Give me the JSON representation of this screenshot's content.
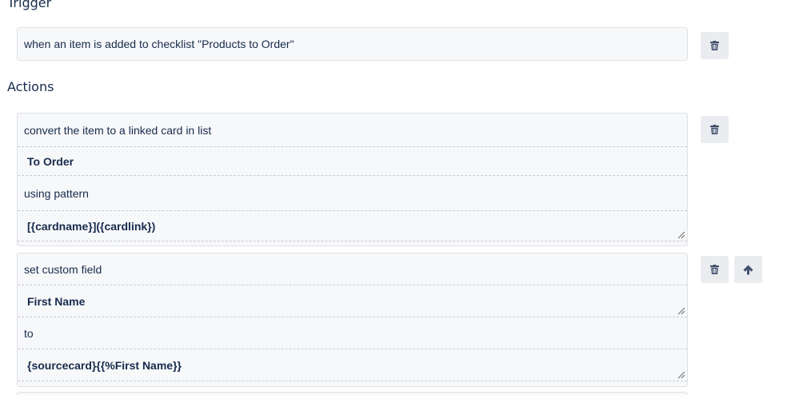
{
  "trigger": {
    "heading": "Trigger",
    "text": "when an item is added to checklist \"Products to Order\""
  },
  "actions": {
    "heading": "Actions",
    "items": [
      {
        "rows": [
          "convert the item to a linked card in list",
          "To Order",
          "using pattern",
          "[{cardname}]({cardlink})"
        ]
      },
      {
        "rows": [
          "set custom field",
          "First Name",
          "to",
          "{sourcecard}{{%First Name}}"
        ]
      }
    ]
  },
  "icons": {
    "delete": "trash-icon",
    "move_up": "arrow-up-icon"
  }
}
